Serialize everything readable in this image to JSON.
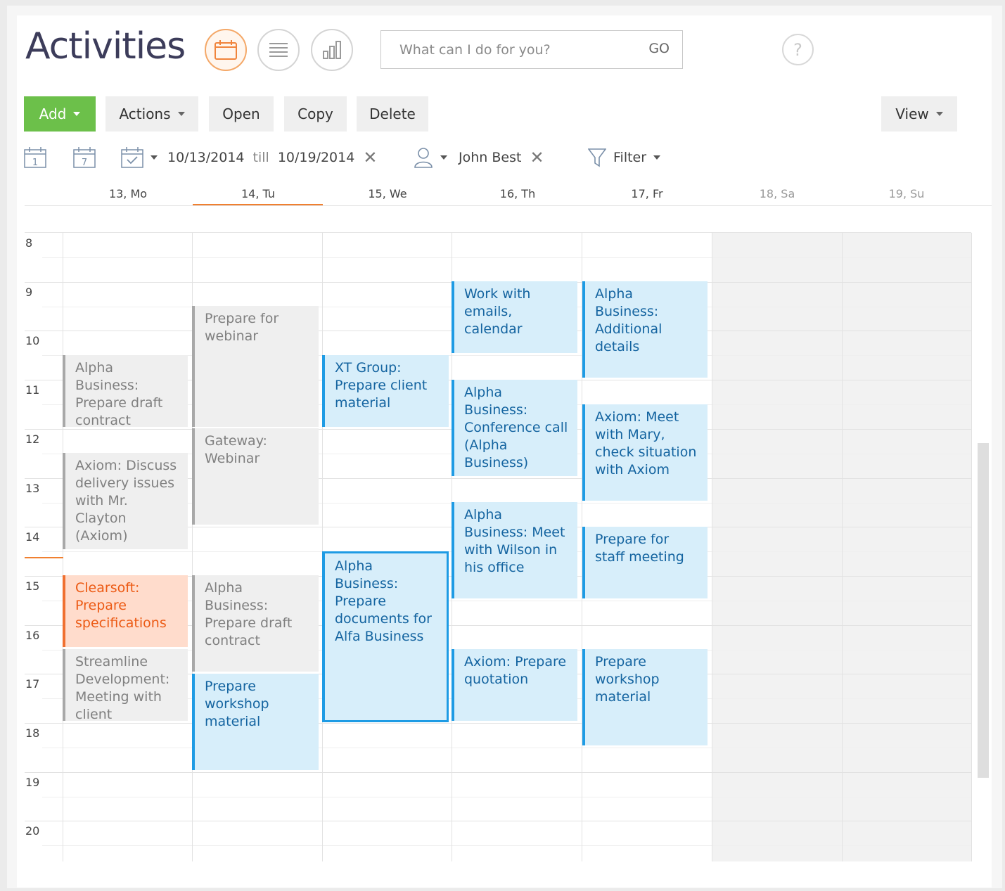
{
  "header": {
    "title": "Activities",
    "search_placeholder": "What can I do for you?",
    "go_label": "GO",
    "help_label": "?"
  },
  "toolbar": {
    "add_label": "Add",
    "actions_label": "Actions",
    "open_label": "Open",
    "copy_label": "Copy",
    "delete_label": "Delete",
    "view_label": "View"
  },
  "filters": {
    "day_icon_text": "1",
    "week_icon_text": "7",
    "date_from": "10/13/2014",
    "till_label": "till",
    "date_to": "10/19/2014",
    "owner": "John Best",
    "filter_label": "Filter"
  },
  "days": [
    "13, Mo",
    "14, Tu",
    "15, We",
    "16, Th",
    "17, Fr",
    "18, Sa",
    "19, Su"
  ],
  "hours": [
    "8",
    "9",
    "10",
    "11",
    "12",
    "13",
    "14",
    "15",
    "16",
    "17",
    "18",
    "19",
    "20"
  ],
  "colors": {
    "accent_green": "#6cc04a",
    "today_orange": "#f08030",
    "event_blue": "#1e9be4",
    "event_gray": "#a8a8a8",
    "event_orange": "#f07030"
  },
  "events": {
    "mo_1": "Alpha Business: Prepare draft contract",
    "mo_2": "Axiom: Discuss delivery issues with Mr. Clayton (Axiom)",
    "mo_3": "Clearsoft: Prepare specifications",
    "mo_4": "Streamline Development: Meeting with client",
    "tu_1": "Prepare for webinar",
    "tu_2": "Gateway: Webinar",
    "tu_3": "Alpha Business: Prepare draft contract",
    "tu_4": "Prepare workshop material",
    "we_1": "XT Group: Prepare client material",
    "we_2": "Alpha Business: Prepare documents for Alfa Business",
    "th_1": "Work with emails, calendar",
    "th_2": "Alpha Business: Conference call (Alpha Business)",
    "th_3": "Alpha Business: Meet with Wilson in his office",
    "th_4": "Axiom: Prepare quotation",
    "fr_1": "Alpha Business: Additional details",
    "fr_2": "Axiom: Meet with Mary, check situation with Axiom",
    "fr_3": "Prepare for staff meeting",
    "fr_4": "Prepare workshop material"
  }
}
